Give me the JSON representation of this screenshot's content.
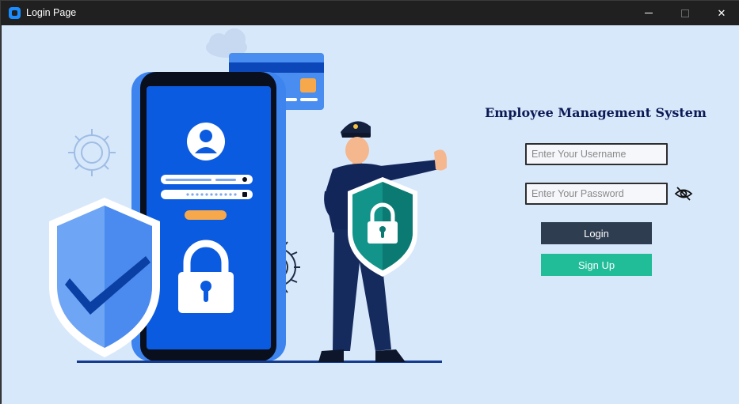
{
  "window": {
    "title": "Login Page",
    "controls": {
      "minimize": "minimize",
      "maximize": "maximize",
      "close": "✕"
    }
  },
  "form": {
    "heading": "Employee Management System",
    "username_placeholder": "Enter Your Username",
    "password_placeholder": "Enter Your Password",
    "toggle_icon": "eye-slash-icon",
    "login_label": "Login",
    "signup_label": "Sign Up"
  },
  "colors": {
    "background": "#d8e8fb",
    "heading": "#0b1a55",
    "login_button": "#2f3d51",
    "signup_button": "#20bd98",
    "phone_screen": "#0b5be0"
  }
}
